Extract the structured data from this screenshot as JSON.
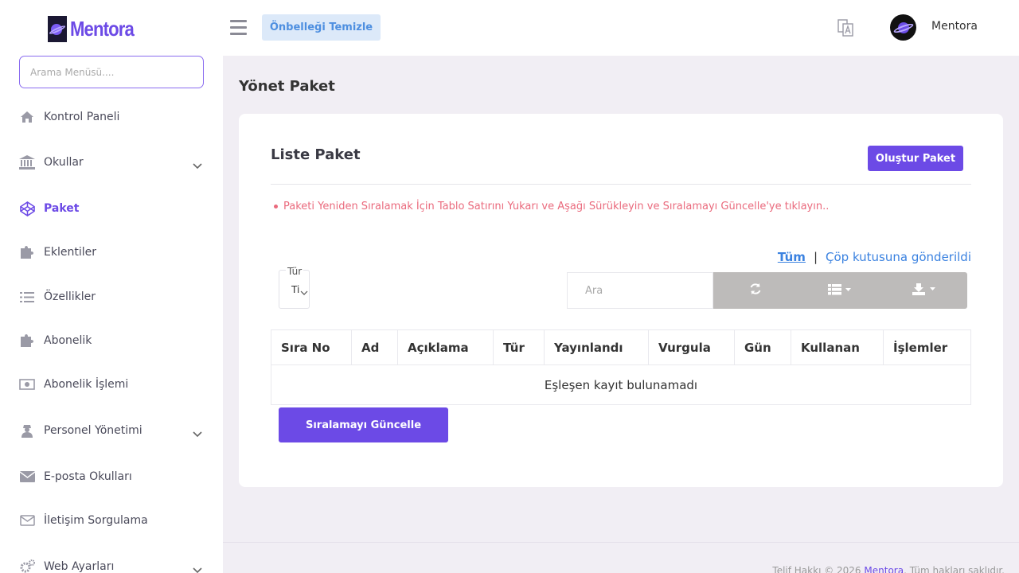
{
  "app": {
    "logo_text": "Mentora",
    "cache_button": "Önbelleği Temizle",
    "user_name": "Mentora"
  },
  "sidebar": {
    "search_placeholder": "Arama Menüsü....",
    "items": [
      {
        "label": "Kontrol Paneli",
        "icon": "home-icon"
      },
      {
        "label": "Okullar",
        "icon": "bank-icon",
        "expandable": true
      },
      {
        "label": "Paket",
        "icon": "codepen-icon",
        "active": true
      },
      {
        "label": "Eklentiler",
        "icon": "puzzle-icon"
      },
      {
        "label": "Özellikler",
        "icon": "list-icon"
      },
      {
        "label": "Abonelik",
        "icon": "puzzle-icon"
      },
      {
        "label": "Abonelik İşlemi",
        "icon": "money-icon"
      },
      {
        "label": "Personel Yönetimi",
        "icon": "user-secret-icon",
        "expandable": true
      },
      {
        "label": "E-posta Okulları",
        "icon": "envelope-icon"
      },
      {
        "label": "İletişim Sorgulama",
        "icon": "envelope-outline-icon"
      },
      {
        "label": "Web Ayarları",
        "icon": "gears-icon",
        "expandable": true
      }
    ]
  },
  "main": {
    "page_title": "Yönet Paket",
    "card_title": "Liste Paket",
    "create_button": "Oluştur Paket",
    "info_note": "Paketi Yeniden Sıralamak İçin Tablo Satırını Yukarı ve Aşağı Sürükleyin ve Sıralamayı Güncelle'ye tıklayın..",
    "filter_all": "Tüm",
    "filter_separator": "|",
    "filter_trash": "Çöp kutusuna gönderildi",
    "type_filter_label": "Tür",
    "type_filter_value": "Ti",
    "table_search_placeholder": "Ara",
    "table": {
      "columns": [
        "Sıra No",
        "Ad",
        "Açıklama",
        "Tür",
        "Yayınlandı",
        "Vurgula",
        "Gün",
        "Kullanan",
        "İşlemler"
      ],
      "empty_message": "Eşleşen kayıt bulunamadı"
    },
    "order_button": "Sıralamayı Güncelle"
  },
  "footer": {
    "prefix": "Telif Hakkı © 2026 ",
    "brand": "Mentora",
    "suffix": ". Tüm hakları saklıdır."
  },
  "colors": {
    "accent": "#6c4ae6",
    "note": "#ea6a7d",
    "link": "#3b82e0",
    "cache_button_bg": "#dce9f9",
    "toolbar_bg": "#bdbbba"
  }
}
